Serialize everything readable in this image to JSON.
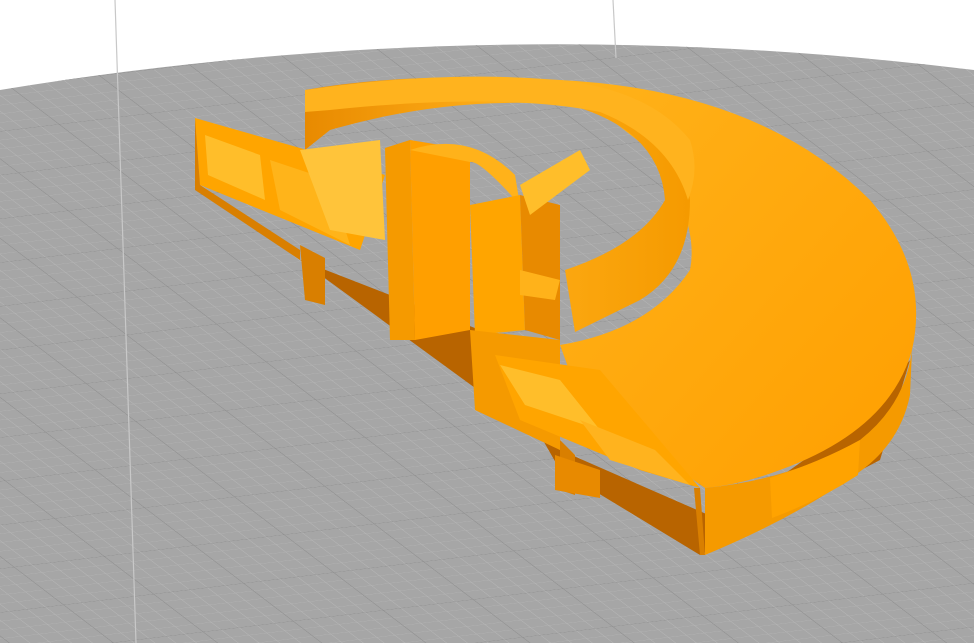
{
  "viewport": {
    "background": "#ffffff",
    "bed_fill": "#a6a6a6",
    "bed_grid_minor": "#b9b9b9",
    "bed_grid_major": "#8c8c8c",
    "axis_line_color": "#c8c8c8"
  },
  "model": {
    "name": "",
    "color_main": "#ffa500",
    "color_light": "#ffbe2a",
    "color_mid": "#f59a00",
    "color_dark": "#d97f00",
    "color_shadow": "#b86400"
  }
}
